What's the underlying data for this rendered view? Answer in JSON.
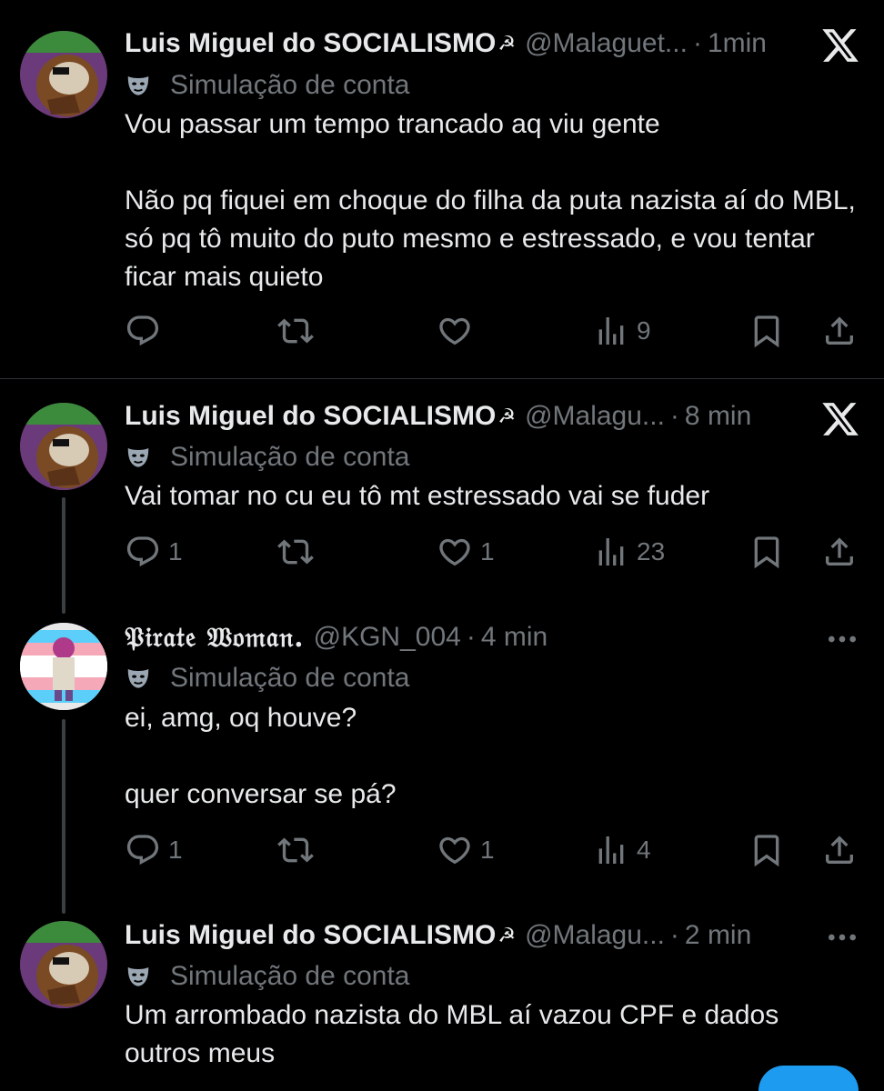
{
  "simulation_label": "Simulação de conta",
  "tweets": [
    {
      "name": "Luis Miguel do SOCIALISMO",
      "name_emoji": "☭",
      "handle": "@Malaguet...",
      "dot": "·",
      "time": "1min",
      "text": "Vou passar um tempo trancado aq viu gente\n\nNão pq fiquei em choque do filha da puta nazista aí do MBL, só pq tô muito do puto mesmo e estressado, e vou tentar ficar mais quieto",
      "replies": "",
      "reposts": "",
      "likes": "",
      "views": "9",
      "corner_icon": "x-logo-icon"
    },
    {
      "name": "Luis Miguel do SOCIALISMO",
      "name_emoji": "☭",
      "handle": "@Malagu...",
      "dot": "·",
      "time": "8 min",
      "text": "Vai tomar no cu eu tô mt estressado vai se fuder",
      "replies": "1",
      "reposts": "",
      "likes": "1",
      "views": "23",
      "corner_icon": "x-logo-icon"
    },
    {
      "name": "𝔓𝔦𝔯𝔞𝔱𝔢 𝔚𝔬𝔪𝔞𝔫.",
      "handle": "@KGN_004",
      "dot": "·",
      "time": "4 min",
      "text": "ei, amg, oq houve?\n\nquer conversar se pá?",
      "replies": "1",
      "reposts": "",
      "likes": "1",
      "views": "4",
      "corner_icon": "more-options-icon"
    },
    {
      "name": "Luis Miguel do SOCIALISMO",
      "name_emoji": "☭",
      "handle": "@Malagu...",
      "dot": "·",
      "time": "2 min",
      "text": "Um arrombado nazista do MBL aí vazou CPF e dados outros meus",
      "corner_icon": "more-options-icon"
    }
  ],
  "colors": {
    "background": "#000000",
    "text_primary": "#e7e9ea",
    "text_secondary": "#71767b",
    "accent": "#1d9bf0",
    "divider": "#2f3336"
  }
}
